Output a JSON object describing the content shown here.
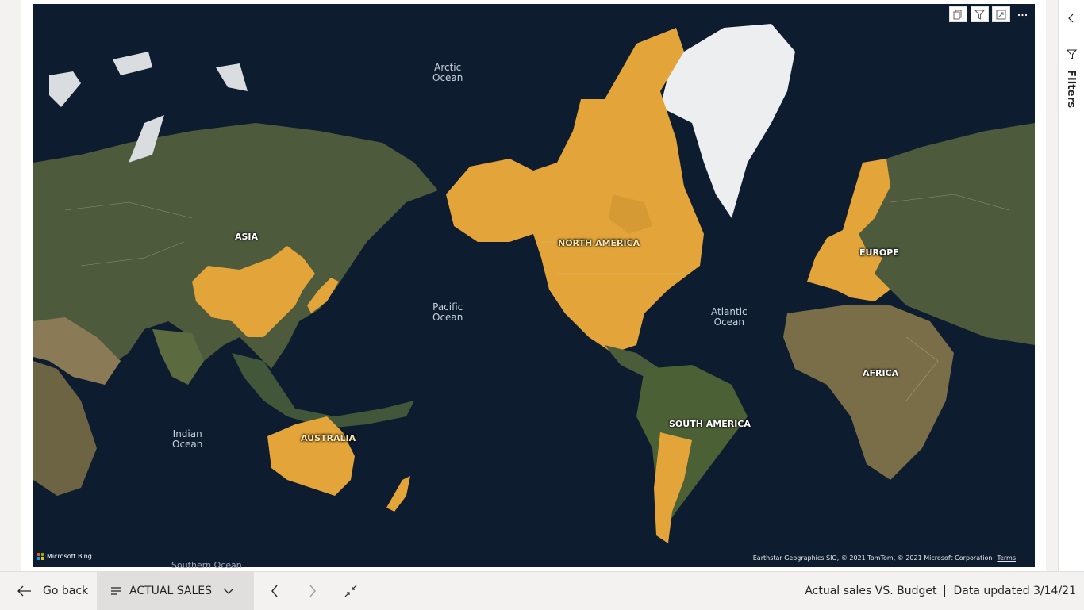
{
  "map": {
    "oceans": {
      "arctic": [
        "Arctic",
        "Ocean"
      ],
      "pacific": [
        "Pacific",
        "Ocean"
      ],
      "atlantic": [
        "Atlantic",
        "Ocean"
      ],
      "indian": [
        "Indian",
        "Ocean"
      ],
      "southern": "Southern Ocean"
    },
    "continents": {
      "asia": "ASIA",
      "north_america": "NORTH AMERICA",
      "europe": "EUROPE",
      "africa": "AFRICA",
      "south_america": "SOUTH AMERICA",
      "australia": "AUSTRALIA"
    },
    "provider": "Microsoft Bing",
    "attribution": "Earthstar Geographics SIO, © 2021 TomTom, © 2021 Microsoft Corporation",
    "terms": "Terms",
    "highlight_color": "#e8a838",
    "land_color": "#4a5a3a",
    "water_color": "#0d1b2e"
  },
  "visual_header": {
    "icons": [
      "copy-icon",
      "filter-icon",
      "focus-mode-icon",
      "more-options-icon"
    ]
  },
  "filters_pane": {
    "label": "Filters"
  },
  "bottom_bar": {
    "go_back": "Go back",
    "page_name": "ACTUAL SALES ...",
    "report_title": "Actual sales VS. Budget",
    "data_updated": "Data updated 3/14/21"
  }
}
